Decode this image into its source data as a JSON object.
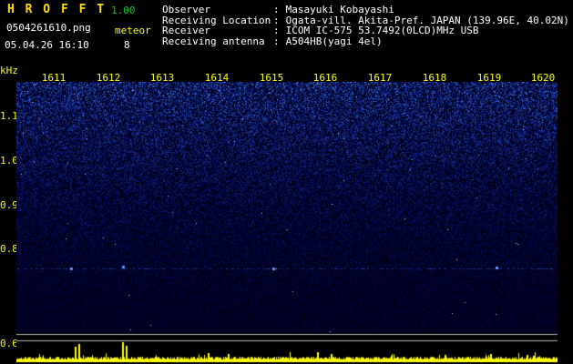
{
  "app": {
    "title": "H R O F F T",
    "version": "1.00",
    "filename": "0504261610.png",
    "mode": "meteor",
    "datetime": "05.04.26 16:10",
    "count": "8"
  },
  "info": {
    "sep": ":",
    "rows": [
      {
        "label": "Observer",
        "value": "Masayuki Kobayashi"
      },
      {
        "label": "Receiving Location",
        "value": "Ogata-vill. Akita-Pref. JAPAN (139.96E, 40.02N)"
      },
      {
        "label": "Receiver",
        "value": "ICOM IC-575 53.7492(0LCD)MHz USB"
      },
      {
        "label": "Receiving antenna",
        "value": "A504HB(yagi 4el)"
      }
    ]
  },
  "axis": {
    "y_unit": "kHz",
    "y_ticks": [
      "1.1",
      "1.0",
      "0.9",
      "0.8",
      "0.6"
    ],
    "x_ticks": [
      "1611",
      "1612",
      "1613",
      "1614",
      "1615",
      "1616",
      "1617",
      "1618",
      "1619",
      "1620"
    ]
  },
  "colors": {
    "background": "#000000",
    "title_yellow": "#ffdd00",
    "version_green": "#00cc33",
    "axis_yellow": "#ffff00",
    "text_white": "#ffffff",
    "spectrogram_blue": "#2244cc",
    "level_trace_yellow": "#ffff00"
  }
}
